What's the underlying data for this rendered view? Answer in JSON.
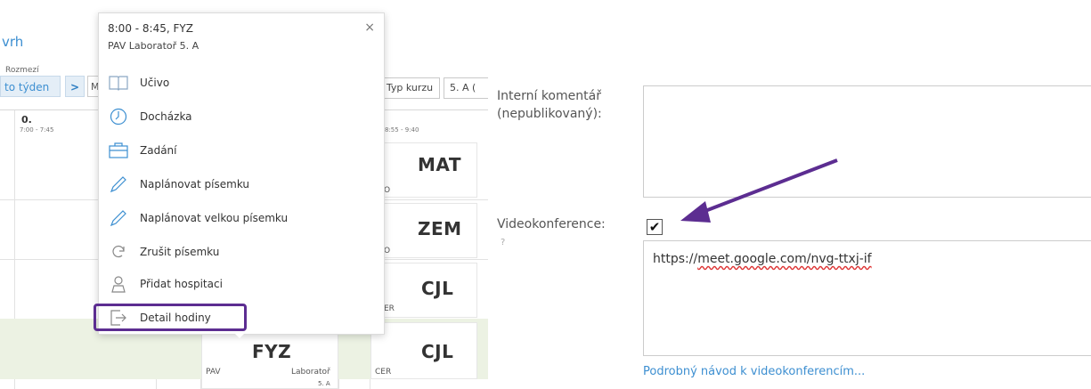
{
  "timetable": {
    "title_fragment": "vrh",
    "rozmezi": "Rozmezí",
    "week_button": "to týden",
    "next_symbol": ">",
    "m_button": "M",
    "typ_kurzu": "Typ kurzu",
    "class_select": "5. A (",
    "period_0": "0.",
    "period_0_time": "7:00 - 7:45",
    "period_col_time": "8:55 - 9:40",
    "cells": [
      {
        "subject": "MAT",
        "sub": "O"
      },
      {
        "subject": "ZEM",
        "sub": "O"
      },
      {
        "subject": "CJL",
        "sub": "ER"
      },
      {
        "subject": "CJL",
        "sub": "CER"
      }
    ],
    "fyz_cell": {
      "subject": "FYZ",
      "teacher": "PAV",
      "room": "Laboratoř",
      "class": "5. A"
    }
  },
  "popup": {
    "title": "8:00 - 8:45, FYZ",
    "subtitle": "PAV Laboratoř 5. A",
    "close": "×",
    "items": [
      {
        "label": "Učivo",
        "icon": "book-icon"
      },
      {
        "label": "Docházka",
        "icon": "clock-icon"
      },
      {
        "label": "Zadání",
        "icon": "briefcase-icon"
      },
      {
        "label": "Naplánovat písemku",
        "icon": "pencil-icon"
      },
      {
        "label": "Naplánovat velkou písemku",
        "icon": "pencil-icon"
      },
      {
        "label": "Zrušit písemku",
        "icon": "refresh-icon"
      },
      {
        "label": "Přidat hospitaci",
        "icon": "person-icon"
      },
      {
        "label": "Detail hodiny",
        "icon": "exit-icon"
      }
    ]
  },
  "form": {
    "internal_comment_label": "Interní komentář (nepublikovaný):",
    "internal_comment_value": "",
    "video_label": "Videokonference:",
    "video_help": "?",
    "video_checked": "✔",
    "video_url_parts": [
      "https://",
      "meet.google.com/nvg-ttxj-if"
    ],
    "help_link": "Podrobný návod k videokonferencím..."
  },
  "colors": {
    "highlight": "#5c2d91",
    "arrow": "#5c2d91",
    "link": "#3d8fd1"
  }
}
